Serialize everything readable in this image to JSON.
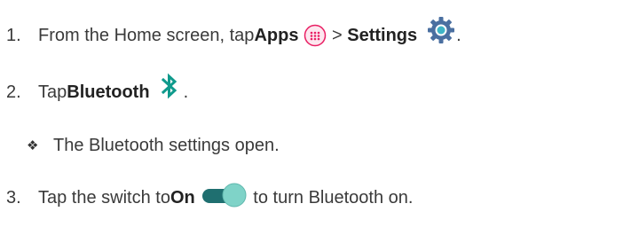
{
  "steps": [
    {
      "num": "1.",
      "text_a": "From the Home screen, tap ",
      "bold_a": "Apps",
      "sep": " > ",
      "bold_b": "Settings",
      "end": "."
    },
    {
      "num": "2.",
      "text_a": "Tap ",
      "bold_a": "Bluetooth",
      "end": "."
    },
    {
      "num": "3.",
      "text_a": "Tap the switch to ",
      "bold_a": "On",
      "text_b": " to turn Bluetooth on."
    }
  ],
  "note": {
    "marker": "❖",
    "text": "The Bluetooth settings open."
  },
  "icons": {
    "apps": "apps-icon",
    "settings": "settings-gear-icon",
    "bluetooth": "bluetooth-icon",
    "toggle": "toggle-switch-on-icon"
  },
  "colors": {
    "apps_icon": "#e91e63",
    "settings_icon": "#4a6fa0",
    "bluetooth_icon": "#0f9a8c",
    "toggle_track": "#1f6f70",
    "toggle_knob": "#7fd3c8"
  }
}
